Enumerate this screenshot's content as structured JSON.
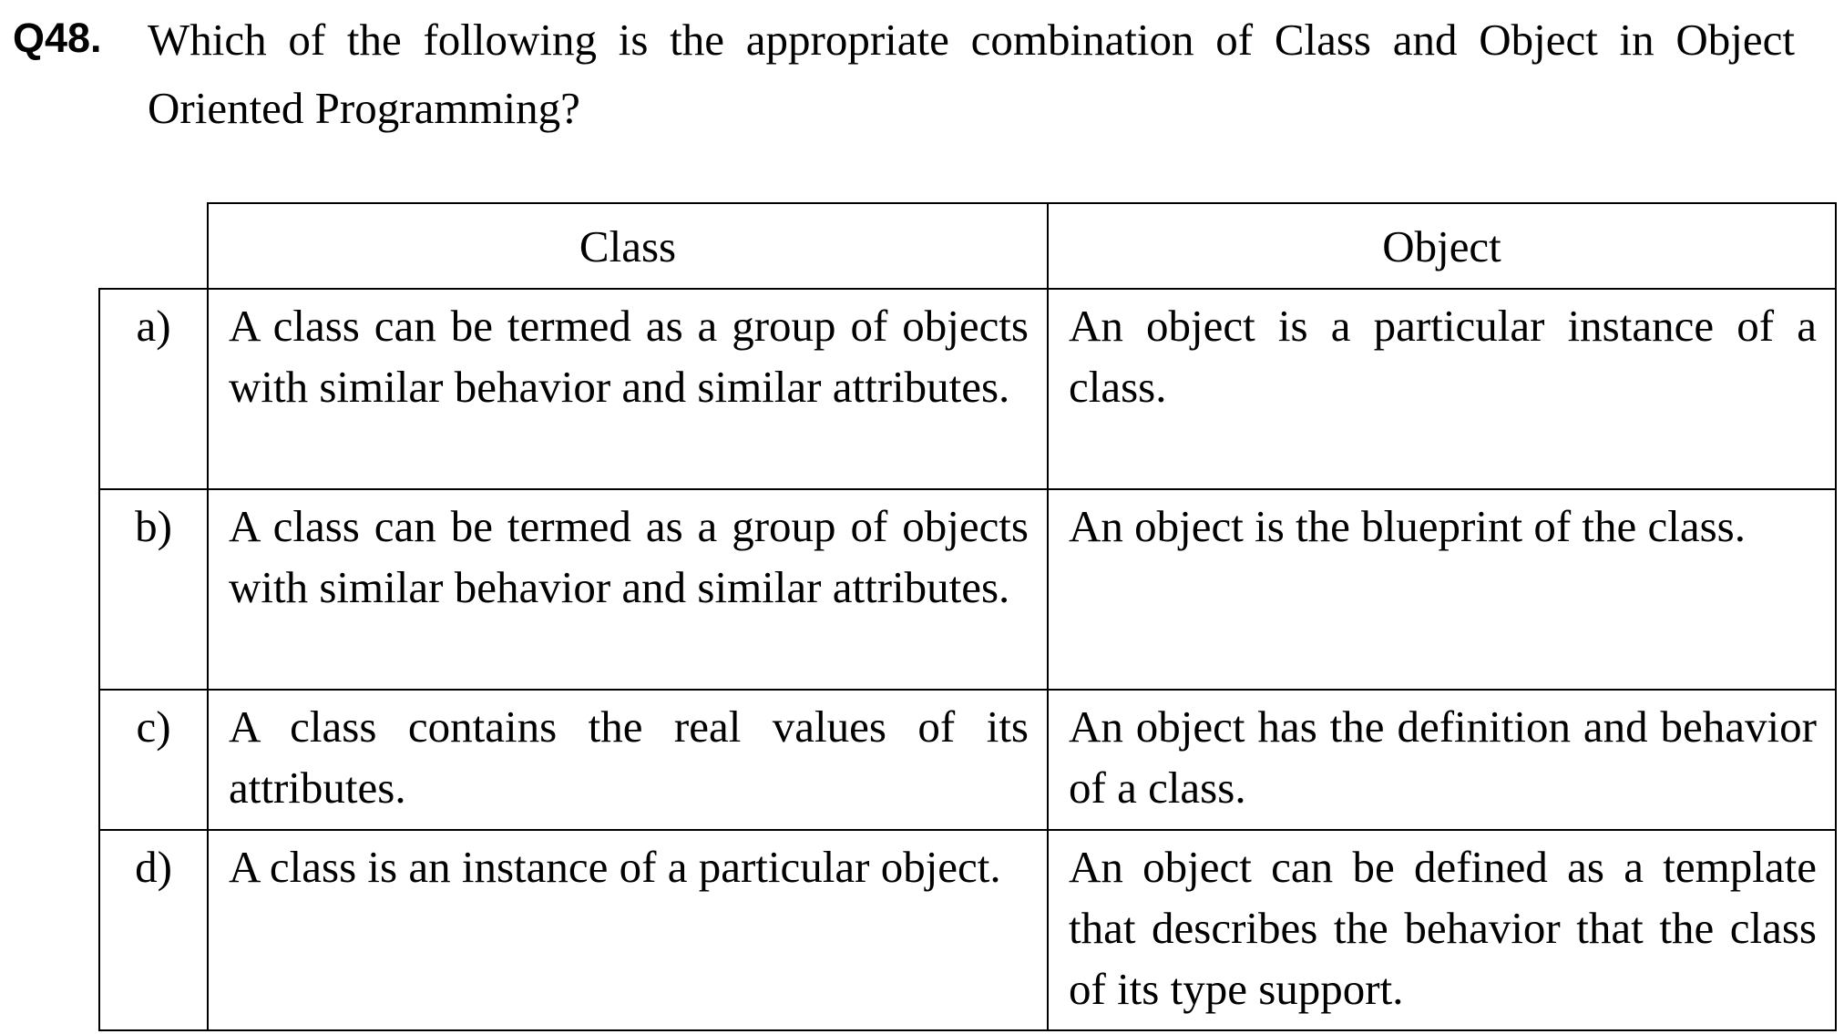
{
  "question": {
    "number": "Q48.",
    "text": "Which of the following is the appropriate combination of Class and Object in Object Oriented Programming?"
  },
  "table": {
    "headers": {
      "class": "Class",
      "object": "Object"
    },
    "rows": [
      {
        "option": "a)",
        "class": "A class can be termed as a group of objects with similar behavior and similar attributes.",
        "object": "An object is a particular instance of a class."
      },
      {
        "option": "b)",
        "class": "A class can be termed as a group of objects with similar behavior and similar attributes.",
        "object": "An object is the blueprint of the class."
      },
      {
        "option": "c)",
        "class": "A class contains the real values of its attributes.",
        "object": "An object has the definition and behavior of a class."
      },
      {
        "option": "d)",
        "class": "A class is an instance of a particular object.",
        "object": "An object can be defined as a template that describes the behavior that the class of its type support."
      }
    ]
  }
}
